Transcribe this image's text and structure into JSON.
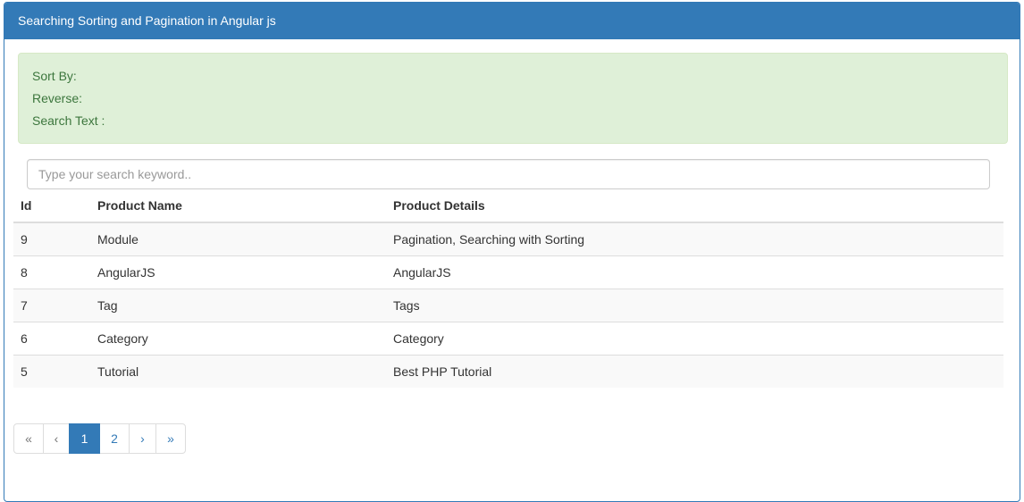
{
  "panel": {
    "title": "Searching Sorting and Pagination in Angular js"
  },
  "status": {
    "sort_by_label": "Sort By:",
    "reverse_label": "Reverse:",
    "search_text_label": "Search Text :"
  },
  "search": {
    "placeholder": "Type your search keyword..",
    "value": ""
  },
  "table": {
    "headers": [
      "Id",
      "Product Name",
      "Product Details"
    ],
    "rows": [
      [
        "9",
        "Module",
        "Pagination, Searching with Sorting"
      ],
      [
        "8",
        "AngularJS",
        "AngularJS"
      ],
      [
        "7",
        "Tag",
        "Tags"
      ],
      [
        "6",
        "Category",
        "Category"
      ],
      [
        "5",
        "Tutorial",
        "Best PHP Tutorial"
      ]
    ]
  },
  "pagination": {
    "first": "«",
    "prev": "‹",
    "pages": [
      "1",
      "2"
    ],
    "current_page": "1",
    "next": "›",
    "last": "»"
  },
  "colors": {
    "primary": "#337ab7",
    "alert_bg": "#dff0d8",
    "alert_text": "#3c763d"
  }
}
